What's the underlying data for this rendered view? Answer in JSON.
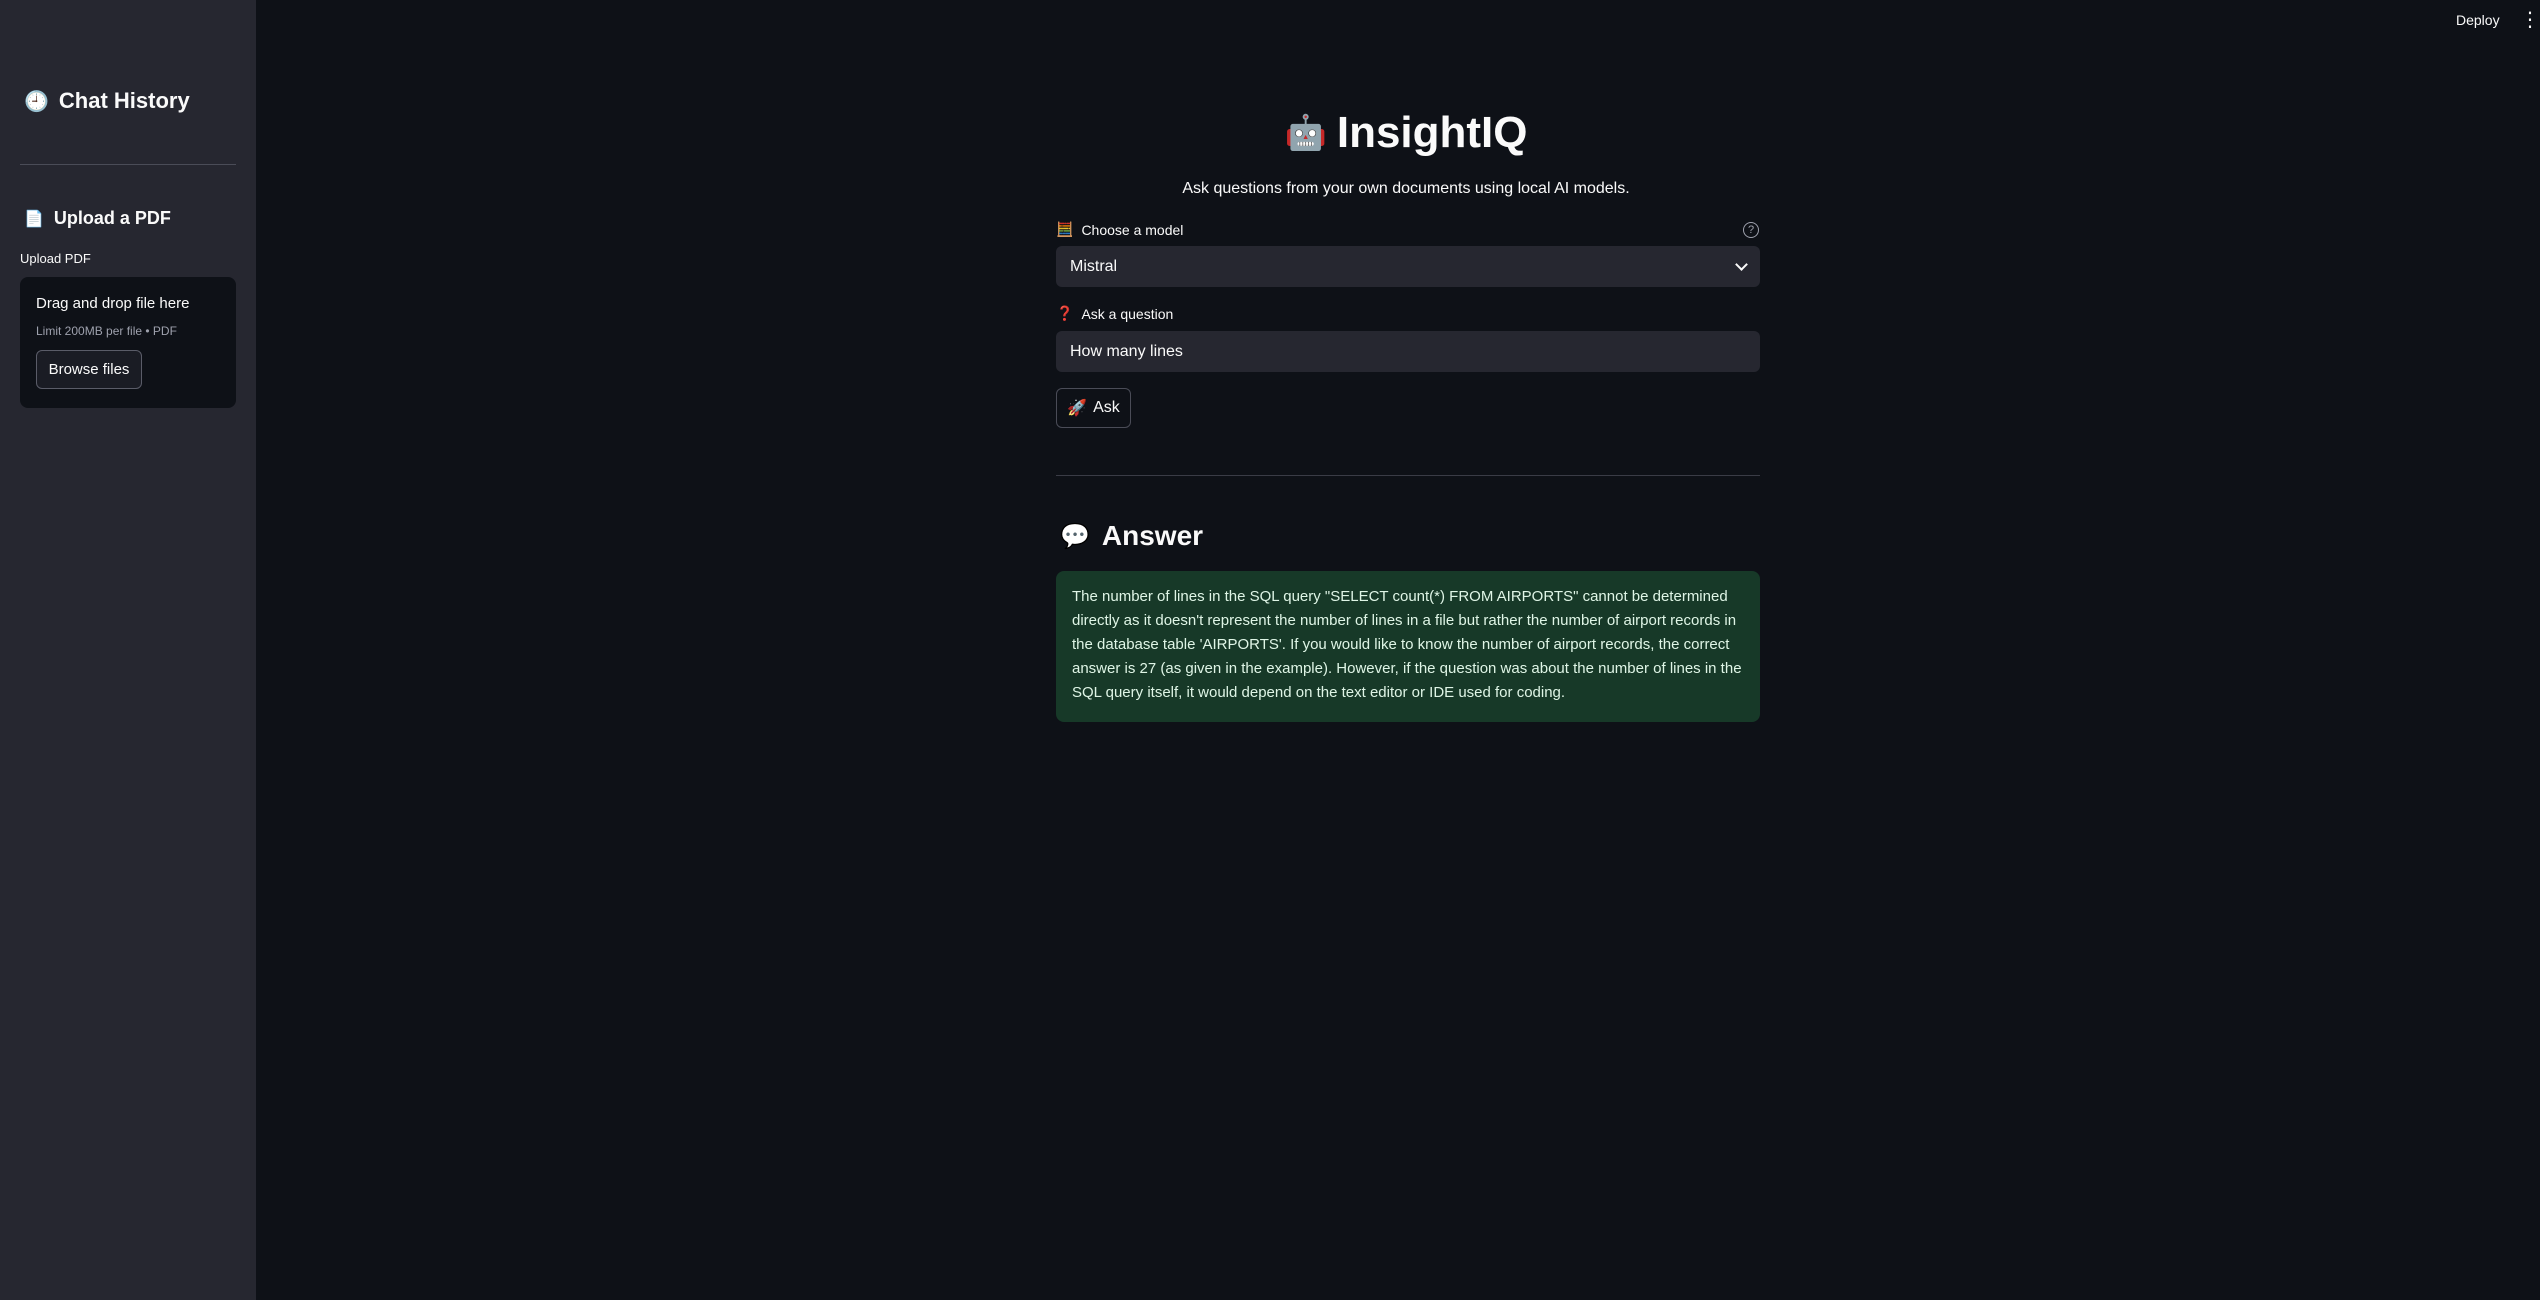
{
  "sidebar": {
    "title": "Chat History",
    "title_icon": "clock-icon",
    "upload_heading": "Upload a PDF",
    "upload_icon": "document-icon",
    "upload_label": "Upload PDF",
    "dropzone_title": "Drag and drop file here",
    "dropzone_sub": "Limit 200MB per file • PDF",
    "browse_label": "Browse files"
  },
  "header": {
    "deploy_label": "Deploy",
    "menu_icon": "vertical-dots-icon"
  },
  "main": {
    "title": "InsightIQ",
    "title_icon": "robot-face-icon",
    "subtitle": "Ask questions from your own documents using local AI models.",
    "model_label": "Choose a model",
    "model_value": "Mistral",
    "question_label": "Ask a question",
    "question_value": "How many lines",
    "ask_label": "Ask",
    "answer_heading": "Answer",
    "answer_text": "The number of lines in the SQL query \"SELECT count(*) FROM AIRPORTS\" cannot be determined directly as it doesn't represent the number of lines in a file but rather the number of airport records in the database table 'AIRPORTS'. If you would like to know the number of airport records, the correct answer is 27 (as given in the example). However, if the question was about the number of lines in the SQL query itself, it would depend on the text editor or IDE used for coding."
  },
  "colors": {
    "background": "#0e1117",
    "sidebar": "#262730",
    "answer_bg": "#173928",
    "answer_text": "#dff5e6"
  }
}
